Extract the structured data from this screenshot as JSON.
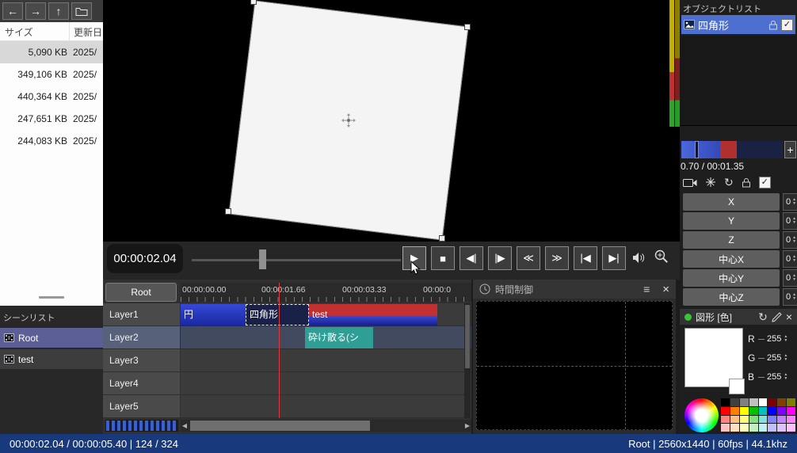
{
  "colors": {
    "status_bar_bg": "#18397c",
    "object_selected_blue": "#4d6fd0",
    "scene_selected_purple": "#5c5f96",
    "playhead_red": "#e03838",
    "clip_blue": "#2236c0",
    "clip_red": "#c23030",
    "clip_teal": "#2f9e95"
  },
  "icons": {
    "back": "←",
    "forward": "→",
    "up": "↑",
    "menu": "≡",
    "close": "×",
    "check": "✓",
    "plus": "+",
    "loop": "↻",
    "spin_up": "▲",
    "spin_down": "▼",
    "scroll_left": "◀",
    "scroll_right": "▶"
  },
  "file_panel": {
    "columns": {
      "size": "サイズ",
      "date": "更新日"
    },
    "rows": [
      {
        "size": "5,090 KB",
        "date": "2025/"
      },
      {
        "size": "349,106 KB",
        "date": "2025/"
      },
      {
        "size": "440,364 KB",
        "date": "2025/"
      },
      {
        "size": "247,651 KB",
        "date": "2025/"
      },
      {
        "size": "244,083 KB",
        "date": "2025/"
      }
    ]
  },
  "scene_panel": {
    "title": "シーンリスト",
    "items": [
      {
        "label": "Root"
      },
      {
        "label": "test"
      }
    ]
  },
  "transport": {
    "timecode": "00:00:02.04",
    "play": "▶",
    "stop": "■",
    "prev_frame": "◀|",
    "next_frame": "|▶",
    "rewind": "≪",
    "fast_forward": "≫",
    "to_start": "|◀",
    "to_end": "▶|"
  },
  "timeline": {
    "scene_button": "Root",
    "ruler_labels": [
      "00:00:00.00",
      "00:00:01.66",
      "00:00:03.33",
      "00:00:0"
    ],
    "layers": [
      "Layer1",
      "Layer2",
      "Layer3",
      "Layer4",
      "Layer5"
    ],
    "clips": [
      {
        "label": "円"
      },
      {
        "label": "四角形"
      },
      {
        "label": "test"
      },
      {
        "label": "砕け散る(シ"
      }
    ]
  },
  "time_control": {
    "title": "時間制御"
  },
  "object_list": {
    "title": "オブジェクトリスト",
    "items": [
      {
        "label": "四角形"
      }
    ]
  },
  "properties": {
    "position_text": "0.70 / 00:01.35",
    "params": [
      {
        "label": "X",
        "value": "0"
      },
      {
        "label": "Y",
        "value": "0"
      },
      {
        "label": "Z",
        "value": "0"
      },
      {
        "label": "中心X",
        "value": "0"
      },
      {
        "label": "中心Y",
        "value": "0"
      },
      {
        "label": "中心Z",
        "value": "0"
      }
    ]
  },
  "color_panel": {
    "title": "図形 [色]",
    "channels": [
      {
        "label": "R",
        "value": "255"
      },
      {
        "label": "G",
        "value": "255"
      },
      {
        "label": "B",
        "value": "255"
      }
    ],
    "palette": [
      "#000000",
      "#404040",
      "#808080",
      "#c0c0c0",
      "#ffffff",
      "#800000",
      "#804000",
      "#808000",
      "#ff0000",
      "#ff8000",
      "#ffff00",
      "#00c000",
      "#00c0c0",
      "#0000ff",
      "#8000ff",
      "#ff00ff",
      "#ff8080",
      "#ffc080",
      "#ffff80",
      "#80e080",
      "#80e0e0",
      "#8080ff",
      "#c080ff",
      "#ff80ff",
      "#ffc0c0",
      "#ffe0c0",
      "#ffffc0",
      "#c0f0c0",
      "#c0f0f0",
      "#c0c0ff",
      "#e0c0ff",
      "#ffc0ff"
    ]
  },
  "status_bar": {
    "left": "00:00:02.04 / 00:00:05.40   |   124 / 324",
    "right": "Root   |   2560x1440   |   60fps   |   44.1khz"
  }
}
